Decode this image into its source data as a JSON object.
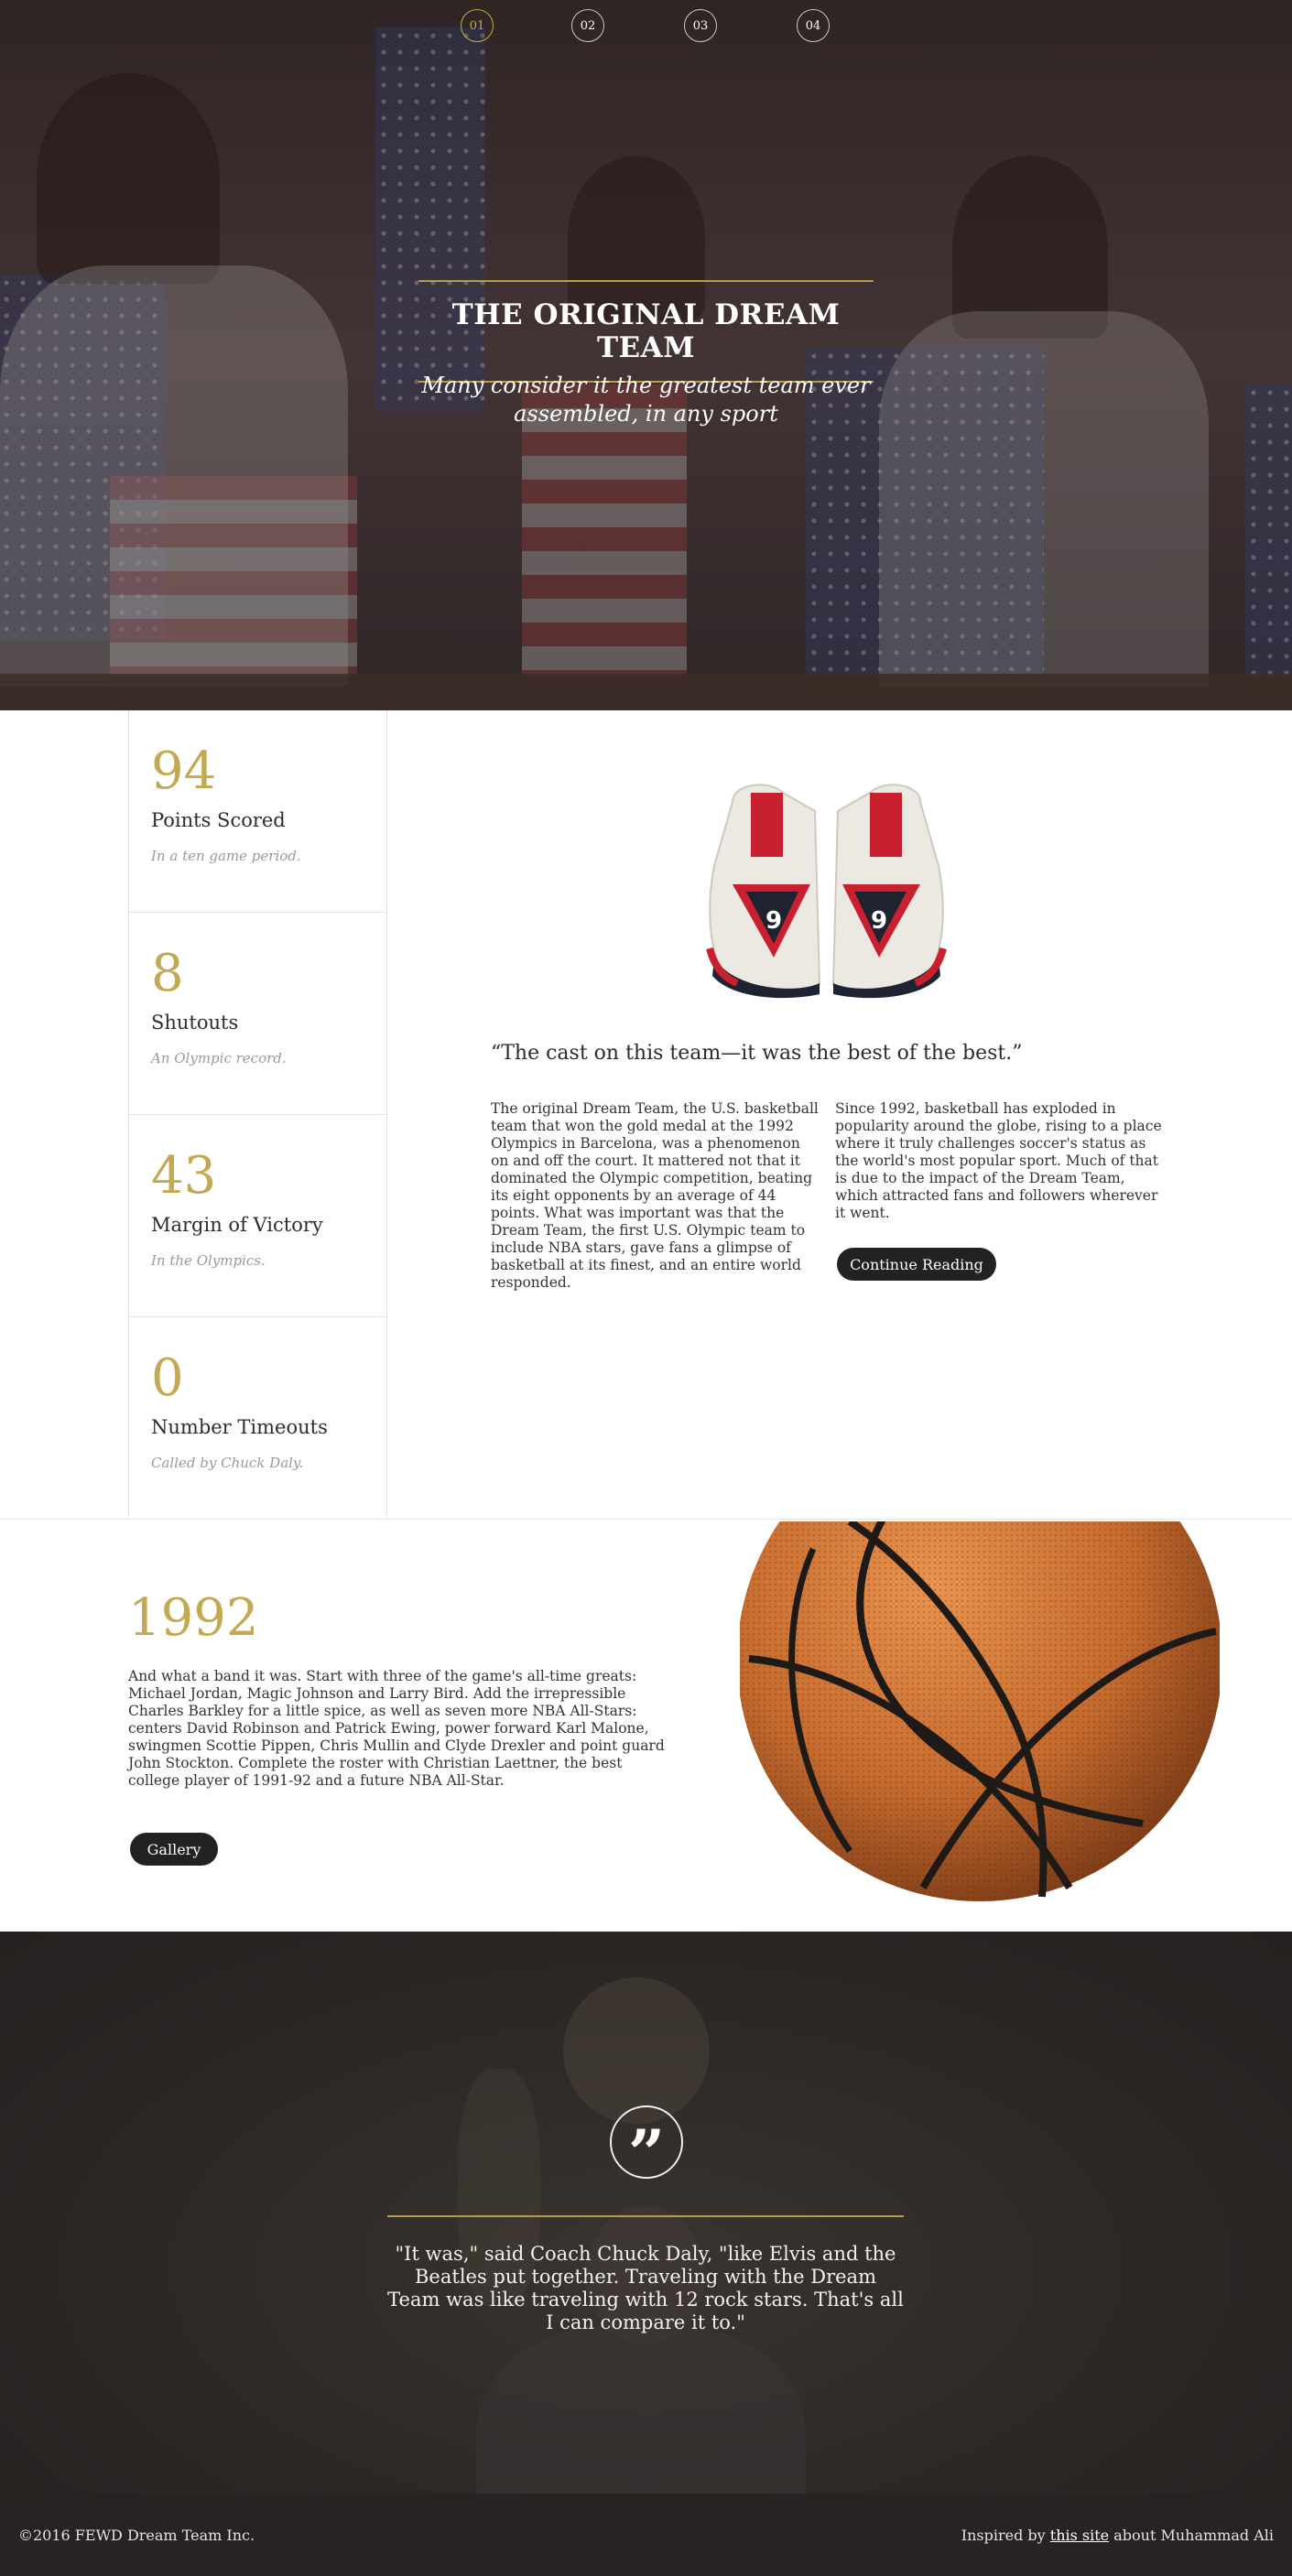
{
  "pager": {
    "items": [
      "01",
      "02",
      "03",
      "04"
    ],
    "active_index": 0
  },
  "hero": {
    "title": "THE ORIGINAL DREAM TEAM",
    "subtitle": "Many consider it the greatest team ever assembled, in any sport"
  },
  "stats": [
    {
      "value": "94",
      "label": "Points Scored",
      "note": "In a ten game period."
    },
    {
      "value": "8",
      "label": "Shutouts",
      "note": "An Olympic record."
    },
    {
      "value": "43",
      "label": "Margin of Victory",
      "note": "In the Olympics."
    },
    {
      "value": "0",
      "label": "Number Timeouts",
      "note": "Called by Chuck Daly."
    }
  ],
  "feature": {
    "quote": "“The cast on this team—it was the best of the best.”",
    "left_text": "The original Dream Team, the U.S. basketball team that won the gold medal at the 1992 Olympics in Barcelona, was a phenomenon on and off the court. It mattered not that it dominated the Olympic competition, beating its eight opponents by an average of 44 points. What was important was that the Dream Team, the first U.S. Olympic team to include NBA stars, gave fans a glimpse of basketball at its finest, and an entire world responded.",
    "right_text": "Since 1992, basketball has exploded in popularity around the globe, rising to a place where it truly challenges soccer's status as the world's most popular sport. Much of that is due to the impact of the Dream Team, which attracted fans and followers wherever it went.",
    "button": "Continue Reading"
  },
  "history": {
    "year": "1992",
    "text": "And what a band it was. Start with three of the game's all-time greats: Michael Jordan, Magic Johnson and Larry Bird. Add the irrepressible Charles Barkley for a little spice, as well as seven more NBA All-Stars: centers David Robinson and Patrick Ewing, power forward Karl Malone, swingmen Scottie Pippen, Chris Mullin and Clyde Drexler and point guard John Stockton. Complete the roster with Christian Laettner, the best college player of 1991-92 and a future NBA All-Star.",
    "button": "Gallery"
  },
  "quote_section": {
    "icon": "quote-icon",
    "text": "\"It was,\" said Coach Chuck Daly, \"like Elvis and the Beatles put together. Traveling with the Dream Team was like traveling with 12 rock stars. That's all I can compare it to.\""
  },
  "footer": {
    "copyright": "©2016 FEWD Dream Team Inc.",
    "credit_prefix": "Inspired by ",
    "credit_link": "this site",
    "credit_suffix": " about Muhammad Ali"
  },
  "colors": {
    "accent_gold": "#c4a953",
    "button_dark": "#222222",
    "footer_bg": "#262322"
  }
}
